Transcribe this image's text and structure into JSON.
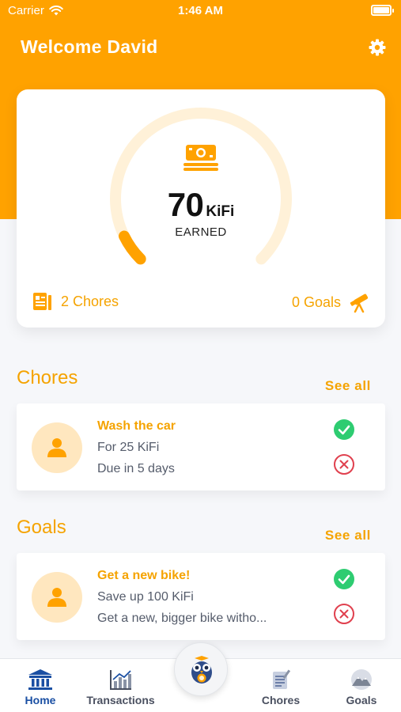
{
  "status": {
    "carrier": "Carrier",
    "time": "1:46 AM"
  },
  "header": {
    "title": "Welcome David"
  },
  "summary": {
    "amount": "70",
    "unit": "KiFi",
    "label": "EARNED",
    "gauge_fill_fraction": 0.07,
    "chores": "2 Chores",
    "goals": "0 Goals"
  },
  "chores": {
    "title": "Chores",
    "see_all": "See all",
    "items": [
      {
        "title": "Wash the car",
        "line1": "For 25 KiFi",
        "line2": "Due in 5 days"
      }
    ]
  },
  "goals": {
    "title": "Goals",
    "see_all": "See all",
    "items": [
      {
        "title": "Get a new bike!",
        "line1": "Save up 100 KiFi",
        "line2": "Get a new, bigger bike witho..."
      }
    ]
  },
  "tabs": [
    {
      "label": "Home",
      "active": true,
      "icon": "bank-icon"
    },
    {
      "label": "Transactions",
      "active": false,
      "icon": "chart-icon"
    },
    {
      "label": "Chores",
      "active": false,
      "icon": "notepad-icon"
    },
    {
      "label": "Goals",
      "active": false,
      "icon": "mountain-icon"
    }
  ],
  "colors": {
    "accent": "#ffa200",
    "primary_text": "#f5a300",
    "active_tab": "#1a4fa3",
    "success": "#2ecc71",
    "danger": "#e0404e"
  }
}
